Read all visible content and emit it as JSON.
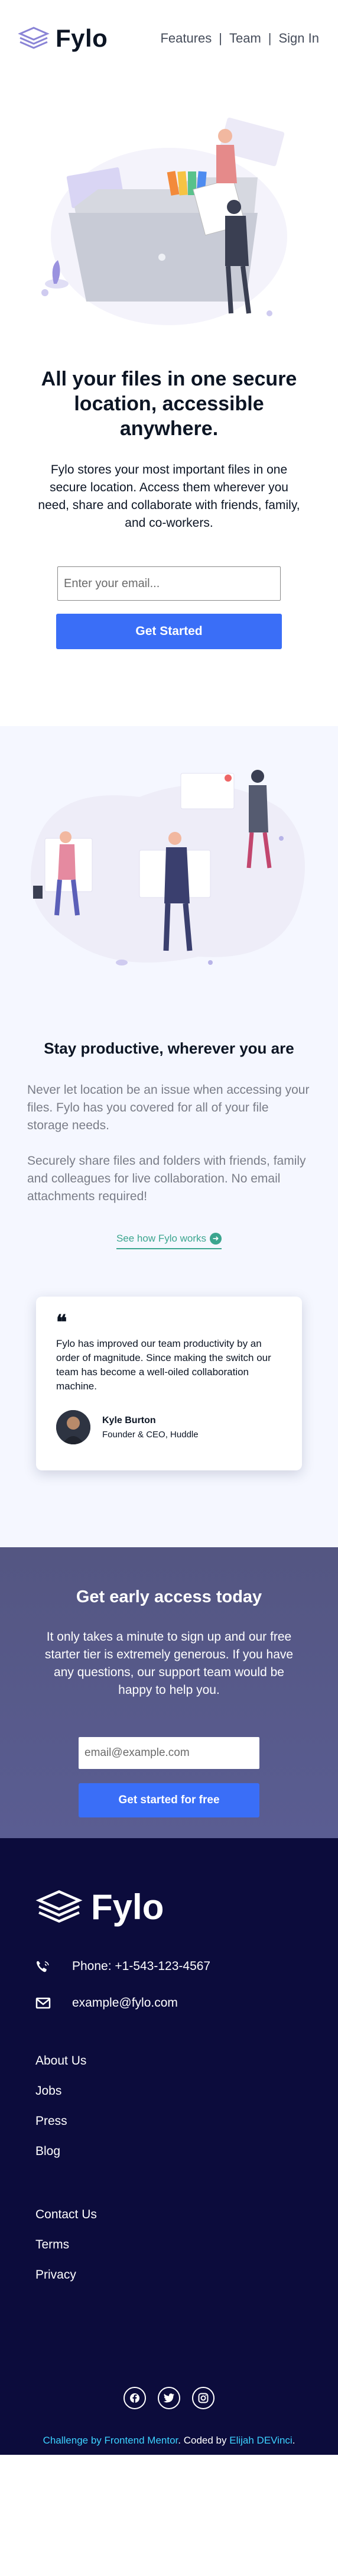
{
  "header": {
    "logo_text": "Fylo",
    "nav": [
      "Features",
      "Team",
      "Sign In"
    ],
    "nav_separator": "|"
  },
  "hero": {
    "title": "All your files in one secure location, accessible anywhere.",
    "description": "Fylo stores your most important files in one secure location. Access them wherever you need, share and collaborate with friends, family, and co-workers.",
    "email_placeholder": "Enter your email...",
    "cta_label": "Get Started"
  },
  "productive": {
    "title": "Stay productive, wherever you are",
    "paragraph_1": "Never let location be an issue when accessing your files. Fylo has you covered for all of your file storage needs.",
    "paragraph_2": "Securely share files and folders with friends, family and colleagues for live collaboration. No email attachments required!",
    "link_label": "See how Fylo works",
    "testimonial": {
      "quote_mark": "❝",
      "text": "Fylo has improved our team productivity by an order of magnitude. Since making the switch our team has become a well-oiled collaboration machine.",
      "name": "Kyle Burton",
      "role": "Founder & CEO, Huddle"
    }
  },
  "early_access": {
    "title": "Get early access today",
    "description": "It only takes a minute to sign up and our free starter tier is extremely generous. If you have any questions, our support team would be happy to help you.",
    "email_placeholder": "email@example.com",
    "cta_label": "Get started for free"
  },
  "footer": {
    "logo_text": "Fylo",
    "phone": "Phone: +1-543-123-4567",
    "email": "example@fylo.com",
    "links_1": [
      "About Us",
      "Jobs",
      "Press",
      "Blog"
    ],
    "links_2": [
      "Contact Us",
      "Terms",
      "Privacy"
    ],
    "attribution": {
      "prefix": "Challenge by ",
      "mentor": "Frontend Mentor",
      "middle": ". Coded by ",
      "author": "Elijah DEVinci",
      "suffix": "."
    }
  },
  "colors": {
    "primary_blue": "#3a6ef7",
    "teal_link": "#3ba58f",
    "early_bg": "#595c8f",
    "footer_bg": "#0c0c3c",
    "attrib_highlight": "#3cd2ff"
  },
  "icons": [
    "logo-icon",
    "arrow-right-icon",
    "phone-icon",
    "email-icon",
    "facebook-icon",
    "twitter-icon",
    "instagram-icon"
  ]
}
